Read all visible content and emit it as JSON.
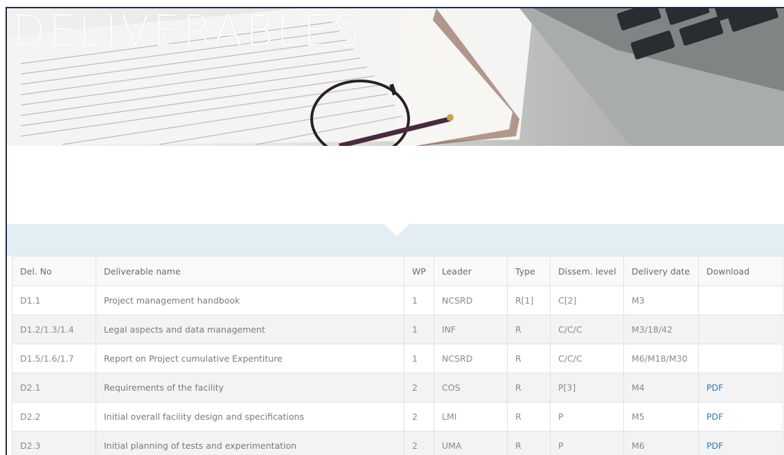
{
  "hero": {
    "title": "DELIVERABLES"
  },
  "table": {
    "headers": [
      "Del. No",
      "Deliverable name",
      "WP",
      "Leader",
      "Type",
      "Dissem. level",
      "Delivery date",
      "Download"
    ],
    "rows": [
      {
        "no": "D1.1",
        "name": "Project management handbook",
        "wp": "1",
        "leader": "NCSRD",
        "type": "R[1]",
        "level": "C[2]",
        "date": "M3",
        "download": ""
      },
      {
        "no": "D1.2/1.3/1.4",
        "name": "Legal aspects and data management",
        "wp": "1",
        "leader": "INF",
        "type": "R",
        "level": "C/C/C",
        "date": "M3/18/42",
        "download": ""
      },
      {
        "no": "D1.5/1.6/1.7",
        "name": "Report on Project cumulative Expentiture",
        "wp": "1",
        "leader": "NCSRD",
        "type": "R",
        "level": "C/C/C",
        "date": "M6/M18/M30",
        "download": ""
      },
      {
        "no": "D2.1",
        "name": "Requirements of the facility",
        "wp": "2",
        "leader": "COS",
        "type": "R",
        "level": "P[3]",
        "date": "M4",
        "download": "PDF"
      },
      {
        "no": "D2.2",
        "name": "Initial overall facility design and specifications",
        "wp": "2",
        "leader": "LMI",
        "type": "R",
        "level": "P",
        "date": "M5",
        "download": "PDF"
      },
      {
        "no": "D2.3",
        "name": "Initial planning of tests and experimentation",
        "wp": "2",
        "leader": "UMA",
        "type": "R",
        "level": "P",
        "date": "M6",
        "download": "PDF"
      }
    ]
  },
  "colors": {
    "link": "#2a7bbd",
    "band": "#e3edf4"
  }
}
